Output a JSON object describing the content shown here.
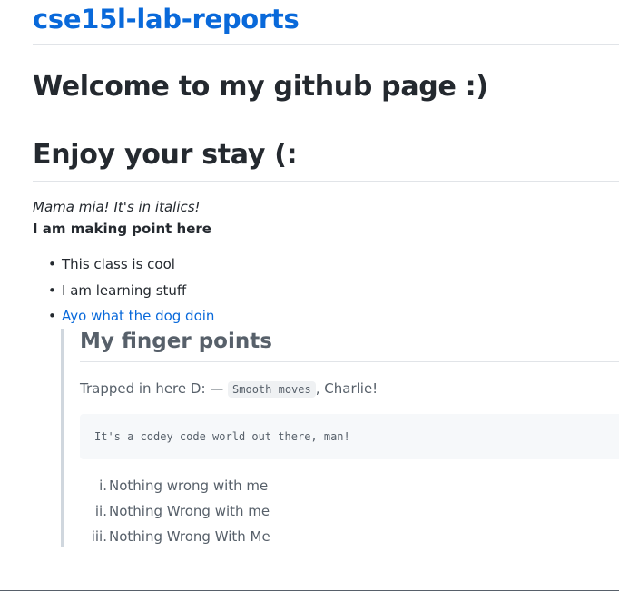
{
  "header": {
    "site_title": "cse15l-lab-reports"
  },
  "headings": {
    "h1": "Welcome to my github page :)",
    "h2": "Enjoy your stay (:"
  },
  "paragraphs": {
    "italic": "Mama mia! It's in italics!",
    "bold": "I am making point here"
  },
  "bullet_list": [
    {
      "text": "This class is cool",
      "link": false
    },
    {
      "text": "I am learning stuff",
      "link": false
    },
    {
      "text": "Ayo what the dog doin",
      "link": true
    }
  ],
  "blockquote": {
    "heading": "My finger points",
    "paragraph_before": "Trapped in here D: — ",
    "inline_code": "Smooth moves",
    "paragraph_after": ", Charlie!",
    "code_block": "It's a codey code world out there, man!",
    "ordered_list": [
      {
        "marker": "i.",
        "text": "Nothing wrong with me"
      },
      {
        "marker": "ii.",
        "text": "Nothing Wrong with me"
      },
      {
        "marker": "iii.",
        "text": "Nothing Wrong With Me"
      }
    ]
  },
  "colors": {
    "link": "#0969da",
    "text": "#24292f",
    "muted": "#57606a",
    "quote_border": "#d0d7de",
    "code_bg": "#f6f8fa"
  }
}
